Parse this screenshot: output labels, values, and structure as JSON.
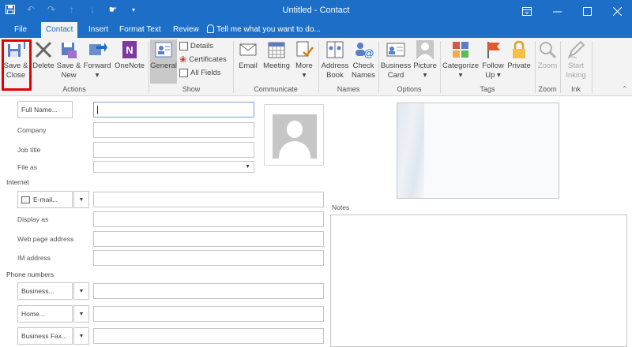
{
  "window": {
    "title": "Untitled - Contact",
    "controls": [
      "ribbon-display-icon",
      "minimize-icon",
      "maximize-icon",
      "close-icon"
    ]
  },
  "qat": [
    "save-icon",
    "undo-icon",
    "redo-icon",
    "up-icon",
    "down-icon",
    "touch-mode-icon",
    "customize-icon"
  ],
  "tabs": [
    "File",
    "Contact",
    "Insert",
    "Format Text",
    "Review"
  ],
  "active_tab": "Contact",
  "tell_me": "Tell me what you want to do...",
  "ribbon": {
    "actions": {
      "label": "Actions",
      "save_close": [
        "Save &",
        "Close"
      ],
      "delete": "Delete",
      "save_new": [
        "Save &",
        "New"
      ],
      "forward": [
        "Forward"
      ],
      "onenote": "OneNote"
    },
    "show": {
      "label": "Show",
      "general": "General",
      "details": "Details",
      "certificates": "Certificates",
      "all_fields": "All Fields"
    },
    "communicate": {
      "label": "Communicate",
      "email": "Email",
      "meeting": "Meeting",
      "more": "More"
    },
    "names": {
      "label": "Names",
      "address_book": [
        "Address",
        "Book"
      ],
      "check_names": [
        "Check",
        "Names"
      ]
    },
    "options": {
      "label": "Options",
      "business_card": [
        "Business",
        "Card"
      ],
      "picture": "Picture"
    },
    "tags": {
      "label": "Tags",
      "categorize": "Categorize",
      "follow_up": [
        "Follow",
        "Up"
      ],
      "private": "Private"
    },
    "zoom": {
      "label": "Zoom",
      "zoom": "Zoom"
    },
    "ink": {
      "label": "Ink",
      "start_inking": [
        "Start",
        "Inking"
      ]
    }
  },
  "form": {
    "full_name_btn": "Full Name...",
    "company": "Company",
    "job_title": "Job title",
    "file_as": "File as",
    "internet": "Internet",
    "email_btn": "E-mail...",
    "display_as": "Display as",
    "web_page": "Web page address",
    "im_address": "IM address",
    "phone_numbers": "Phone numbers",
    "business_btn": "Business...",
    "home_btn": "Home...",
    "business_fax_btn": "Business Fax...",
    "notes": "Notes"
  },
  "colors": {
    "accent": "#1d6ec6",
    "highlight": "#e00000"
  }
}
